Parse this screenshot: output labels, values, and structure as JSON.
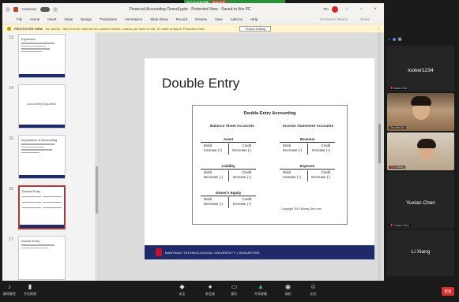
{
  "zoom_share_banner": {
    "text": "您正在共享屏幕",
    "stop_label": "结束共享"
  },
  "ppt": {
    "autosave_label": "AutoSave",
    "toggle_state": "Off",
    "doc_title": "Financial Accounting Overall.pptx - Protected View - Saved to this PC",
    "user": "Tan",
    "menu": [
      "File",
      "Home",
      "Insert",
      "Draw",
      "Design",
      "Transitions",
      "Animations",
      "Slide Show",
      "Record",
      "Review",
      "View",
      "Add-ins",
      "Help"
    ],
    "menu_right": [
      "Present in Teams",
      "Share"
    ],
    "protected_bar": {
      "label": "PROTECTED VIEW",
      "message": "Be careful - files from the Internet can contain viruses. Unless you need to edit, it's safer to stay in Protected View.",
      "button": "Enable Editing"
    },
    "thumbnails": [
      {
        "num": "13",
        "title": "Expenses",
        "kind": "list"
      },
      {
        "num": "14",
        "title": "Accounting Equation",
        "kind": "center"
      },
      {
        "num": "15",
        "title": "Importance of Accounting",
        "kind": "list"
      },
      {
        "num": "16",
        "title": "Double Entry",
        "kind": "grid"
      },
      {
        "num": "17",
        "title": "Double Entry",
        "kind": "list"
      }
    ],
    "slide": {
      "title": "Double Entry",
      "diagram_title": "Double-Entry Accounting",
      "left_heading": "Balance Sheet Accounts",
      "right_heading": "Income Statement Accounts",
      "accounts": {
        "asset": {
          "name": "Asset",
          "debit": "Debit",
          "credit": "Credit",
          "dr": "Increase (+)",
          "cr": "Decrease (-)"
        },
        "liability": {
          "name": "Liability",
          "debit": "Debit",
          "credit": "Credit",
          "dr": "Decrease (-)",
          "cr": "Increase (+)"
        },
        "equity": {
          "name": "Owner's Equity",
          "debit": "Debit",
          "credit": "Credit",
          "dr": "Decrease (-)",
          "cr": "Increase (+)"
        },
        "revenue": {
          "name": "Revenue",
          "debit": "Debit",
          "credit": "Credit",
          "dr": "Decrease (-)",
          "cr": "Increase (+)"
        },
        "expense": {
          "name": "Expense",
          "debit": "Debit",
          "credit": "Credit",
          "dr": "Increase (+)",
          "cr": "Decrease (-)"
        }
      },
      "copyright": "Copyright 2013 Money-Zine.com",
      "footer": "NANYANG TECHNOLOGICAL UNIVERSITY | SINGAPORE"
    }
  },
  "zoom_panel": {
    "participants": [
      {
        "name": "looker1234",
        "tag": "looker1234"
      },
      {
        "name": "",
        "tag": "Tan Wei Jie"
      },
      {
        "name": "",
        "tag": "Li Xiang"
      },
      {
        "name": "Yuxian Chen",
        "tag": "Yuxian Chen"
      },
      {
        "name": "Li Xiang",
        "tag": ""
      }
    ]
  },
  "zoom_toolbar": {
    "left": [
      {
        "label": "解除静音",
        "icon": "microphone-icon"
      },
      {
        "label": "开启视频",
        "icon": "camera-icon"
      }
    ],
    "center": [
      {
        "label": "安全",
        "icon": "shield-icon"
      },
      {
        "label": "参会者",
        "icon": "people-icon"
      },
      {
        "label": "聊天",
        "icon": "chat-icon"
      },
      {
        "label": "共享屏幕",
        "icon": "share-icon"
      },
      {
        "label": "录制",
        "icon": "record-icon"
      },
      {
        "label": "反应",
        "icon": "reaction-icon"
      }
    ],
    "end_label": "结束"
  }
}
